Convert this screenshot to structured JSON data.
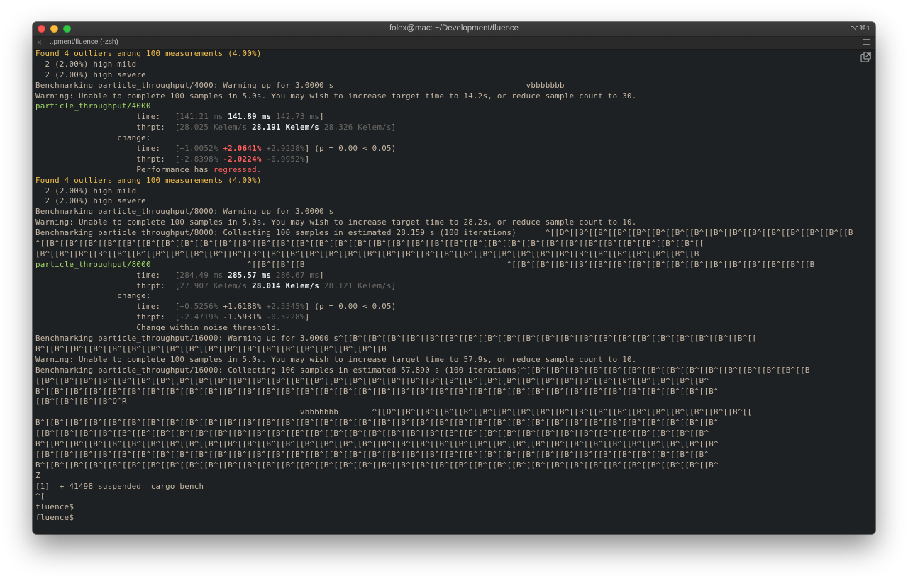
{
  "window": {
    "title": "folex@mac: ~/Development/fluence",
    "shortcut": "⌥⌘1",
    "tab_label": "..pment/fluence (-zsh)"
  },
  "terminal": {
    "lines": [
      [
        {
          "t": "Found 4 outliers among 100 measurements (4.00%)",
          "c": "y"
        }
      ],
      [
        {
          "t": "  2 (2.00%) high mild"
        }
      ],
      [
        {
          "t": "  2 (2.00%) high severe"
        }
      ],
      [
        {
          "t": "Benchmarking particle_throughput/4000: Warming up for 3.0000 s                                        vbbbbbbb"
        }
      ],
      [
        {
          "t": "Warning: Unable to complete 100 samples in 5.0s. You may wish to increase target time to 14.2s, or reduce sample count to 30."
        }
      ],
      [
        {
          "t": "particle_throughput/4000",
          "c": "g"
        }
      ],
      [
        {
          "t": "                     time:   ["
        },
        {
          "t": "141.21 ms",
          "c": "dim"
        },
        {
          "t": " "
        },
        {
          "t": "141.89 ms",
          "c": "b"
        },
        {
          "t": " "
        },
        {
          "t": "142.73 ms",
          "c": "dim"
        },
        {
          "t": "]"
        }
      ],
      [
        {
          "t": "                     thrpt:  ["
        },
        {
          "t": "28.025 Kelem/s",
          "c": "dim"
        },
        {
          "t": " "
        },
        {
          "t": "28.191 Kelem/s",
          "c": "b"
        },
        {
          "t": " "
        },
        {
          "t": "28.326 Kelem/s",
          "c": "dim"
        },
        {
          "t": "]"
        }
      ],
      [
        {
          "t": "                 change:"
        }
      ],
      [
        {
          "t": "                     time:   ["
        },
        {
          "t": "+1.0052%",
          "c": "dim"
        },
        {
          "t": " "
        },
        {
          "t": "+2.0641%",
          "c": "rb"
        },
        {
          "t": " "
        },
        {
          "t": "+2.9228%",
          "c": "dim"
        },
        {
          "t": "] (p = 0.00 < 0.05)"
        }
      ],
      [
        {
          "t": "                     thrpt:  ["
        },
        {
          "t": "-2.8398%",
          "c": "dim"
        },
        {
          "t": " "
        },
        {
          "t": "-2.0224%",
          "c": "rb"
        },
        {
          "t": " "
        },
        {
          "t": "-0.9952%",
          "c": "dim"
        },
        {
          "t": "]"
        }
      ],
      [
        {
          "t": "                     Performance has "
        },
        {
          "t": "regressed.",
          "c": "r"
        }
      ],
      [
        {
          "t": "Found 4 outliers among 100 measurements (4.00%)",
          "c": "y"
        }
      ],
      [
        {
          "t": "  2 (2.00%) high mild"
        }
      ],
      [
        {
          "t": "  2 (2.00%) high severe"
        }
      ],
      [
        {
          "t": "Benchmarking particle_throughput/8000: Warming up for 3.0000 s"
        }
      ],
      [
        {
          "t": "Warning: Unable to complete 100 samples in 5.0s. You may wish to increase target time to 28.2s, or reduce sample count to 10."
        }
      ],
      [
        {
          "t": "Benchmarking particle_throughput/8000: Collecting 100 samples in estimated 28.159 s (100 iterations)      ^[[D^[[B^[[B^[[B^[[B^[[B^[[B^[[B^[[B^[[B^[[B^[[B^[[B^[[B^[[B^[[B"
        }
      ],
      [
        {
          "t": "^[[B^[[B^[[B^[[B^[[B^[[B^[[B^[[B^[[B^[[B^[[B^[[B^[[B^[[B^[[B^[[B^[[B^[[B^[[B^[[B^[[B^[[B^[[B^[[B^[[B^[[B^[[B^[[B^[[B^[[B^[[B^[[B^[[B^[[B^[["
        }
      ],
      [
        {
          "t": "[B^[[B^[[B^[[B^[[B^[[B^[[B^[[B^[[B^[[B^[[B^[[B^[[B^[[B^[[B^[[B^[[B^[[B^[[B^[[B^[[B^[[B^[[B^[[B^[[B^[[B^[[B^[[B^[[B^[[B^[[B^[[B^[[B^[[B^[[B"
        }
      ],
      [
        {
          "t": "particle_throughput/8000",
          "c": "g"
        },
        {
          "t": "                    ^[[B^[[B^[[B                                          ^[[B^[[B^[[B^[[B^[[B^[[B^[[B^[[B^[[B^[[B^[[B^[[B^[[B^[[B^[[B^[[B"
        }
      ],
      [
        {
          "t": "                     time:   ["
        },
        {
          "t": "284.49 ms",
          "c": "dim"
        },
        {
          "t": " "
        },
        {
          "t": "285.57 ms",
          "c": "b"
        },
        {
          "t": " "
        },
        {
          "t": "286.67 ms",
          "c": "dim"
        },
        {
          "t": "]"
        }
      ],
      [
        {
          "t": "                     thrpt:  ["
        },
        {
          "t": "27.907 Kelem/s",
          "c": "dim"
        },
        {
          "t": " "
        },
        {
          "t": "28.014 Kelem/s",
          "c": "b"
        },
        {
          "t": " "
        },
        {
          "t": "28.121 Kelem/s",
          "c": "dim"
        },
        {
          "t": "]"
        }
      ],
      [
        {
          "t": "                 change:"
        }
      ],
      [
        {
          "t": "                     time:   ["
        },
        {
          "t": "+0.5256%",
          "c": "dim"
        },
        {
          "t": " +1.6188% "
        },
        {
          "t": "+2.5345%",
          "c": "dim"
        },
        {
          "t": "] (p = 0.00 < 0.05)"
        }
      ],
      [
        {
          "t": "                     thrpt:  ["
        },
        {
          "t": "-2.4719%",
          "c": "dim"
        },
        {
          "t": " -1.5931% "
        },
        {
          "t": "-0.5228%",
          "c": "dim"
        },
        {
          "t": "]"
        }
      ],
      [
        {
          "t": "                     Change within noise threshold."
        }
      ],
      [
        {
          "t": "Benchmarking particle_throughput/16000: Warming up for 3.0000 s^[[B^[[B^[[B^[[B^[[B^[[B^[[B^[[B^[[B^[[B^[[B^[[B^[[B^[[B^[[B^[[B^[[B^[[B^[[B^[[B^[[B^[["
        }
      ],
      [
        {
          "t": "B^[[B^[[B^[[B^[[B^[[B^[[B^[[B^[[B^[[B^[[B^[[B^[[B^[[B^[[B^[[B^[[B^[[B^[[B"
        }
      ],
      [
        {
          "t": "Warning: Unable to complete 100 samples in 5.0s. You may wish to increase target time to 57.9s, or reduce sample count to 10."
        }
      ],
      [
        {
          "t": "Benchmarking particle_throughput/16000: Collecting 100 samples in estimated 57.890 s (100 iterations)^[[B^[[B^[[B^[[B^[[B^[[B^[[B^[[B^[[B^[[B^[[B^[[B^[[B^[[B^[[B"
        }
      ],
      [
        {
          "t": "[[B^[[B^[[B^[[B^[[B^[[B^[[B^[[B^[[B^[[B^[[B^[[B^[[B^[[B^[[B^[[B^[[B^[[B^[[B^[[B^[[B^[[B^[[B^[[B^[[B^[[B^[[B^[[B^[[B^[[B^[[B^[[B^[[B^[[B^[[B^"
        }
      ],
      [
        {
          "t": "B^[[B^[[B^[[B^[[B^[[B^[[B^[[B^[[B^[[B^[[B^[[B^[[B^[[B^[[B^[[B^[[B^[[B^[[B^[[B^[[B^[[B^[[B^[[B^[[B^[[B^[[B^[[B^[[B^[[B^[[B^[[B^[[B^[[B^[[B^[[B^"
        }
      ],
      [
        {
          "t": "[[B^[[B^[[B^[[B^O^R"
        }
      ],
      [
        {
          "t": "                                                       vbbbbbbb       ^[[D^[[B^[[B^[[B^[[B^[[B^[[B^[[B^[[B^[[B^[[B^[[B^[[B^[[B^[[B^[[B^[[B^[[B^[[B^[["
        }
      ],
      [
        {
          "t": "B^[[B^[[B^[[B^[[B^[[B^[[B^[[B^[[B^[[B^[[B^[[B^[[B^[[B^[[B^[[B^[[B^[[B^[[B^[[B^[[B^[[B^[[B^[[B^[[B^[[B^[[B^[[B^[[B^[[B^[[B^[[B^[[B^[[B^[[B^[[B^"
        }
      ],
      [
        {
          "t": "[[B^[[B^[[B^[[B^[[B^[[B^[[B^[[B^[[B^[[B^[[B^[[B^[[B^[[B^[[B^[[B^[[B^[[B^[[B^[[B^[[B^[[B^[[B^[[B^[[B^[[B^[[B^[[B^[[B^[[B^[[B^[[B^[[B^[[B^[[B^"
        }
      ],
      [
        {
          "t": "B^[[B^[[B^[[B^[[B^[[B^[[B^[[B^[[B^[[B^[[B^[[B^[[B^[[B^[[B^[[B^[[B^[[B^[[B^[[B^[[B^[[B^[[B^[[B^[[B^[[B^[[B^[[B^[[B^[[B^[[B^[[B^[[B^[[B^[[B^[[B^"
        }
      ],
      [
        {
          "t": "[[B^[[B^[[B^[[B^[[B^[[B^[[B^[[B^[[B^[[B^[[B^[[B^[[B^[[B^[[B^[[B^[[B^[[B^[[B^[[B^[[B^[[B^[[B^[[B^[[B^[[B^[[B^[[B^[[B^[[B^[[B^[[B^[[B^[[B^[[B^"
        }
      ],
      [
        {
          "t": "B^[[B^[[B^[[B^[[B^[[B^[[B^[[B^[[B^[[B^[[B^[[B^[[B^[[B^[[B^[[B^[[B^[[B^[[B^[[B^[[B^[[B^[[B^[[B^[[B^[[B^[[B^[[B^[[B^[[B^[[B^[[B^[[B^[[B^[[B^[[B^"
        }
      ],
      [
        {
          "t": "Z"
        }
      ],
      [
        {
          "t": "[1]  + 41498 suspended  cargo bench"
        }
      ],
      [
        {
          "t": "^["
        }
      ],
      [
        {
          "t": "fluence$"
        }
      ],
      [
        {
          "t": "fluence$"
        }
      ]
    ]
  },
  "icons": {
    "popout": "external-window-icon",
    "close_tab": "close-icon",
    "tab_menu": "hamburger-menu-icon"
  },
  "colors": {
    "background": "#1d2123",
    "text": "#c8b8a6",
    "warning_yellow": "#f3bf4f",
    "benchmark_green": "#a6d96a",
    "regressed_red": "#ff5f5f"
  }
}
